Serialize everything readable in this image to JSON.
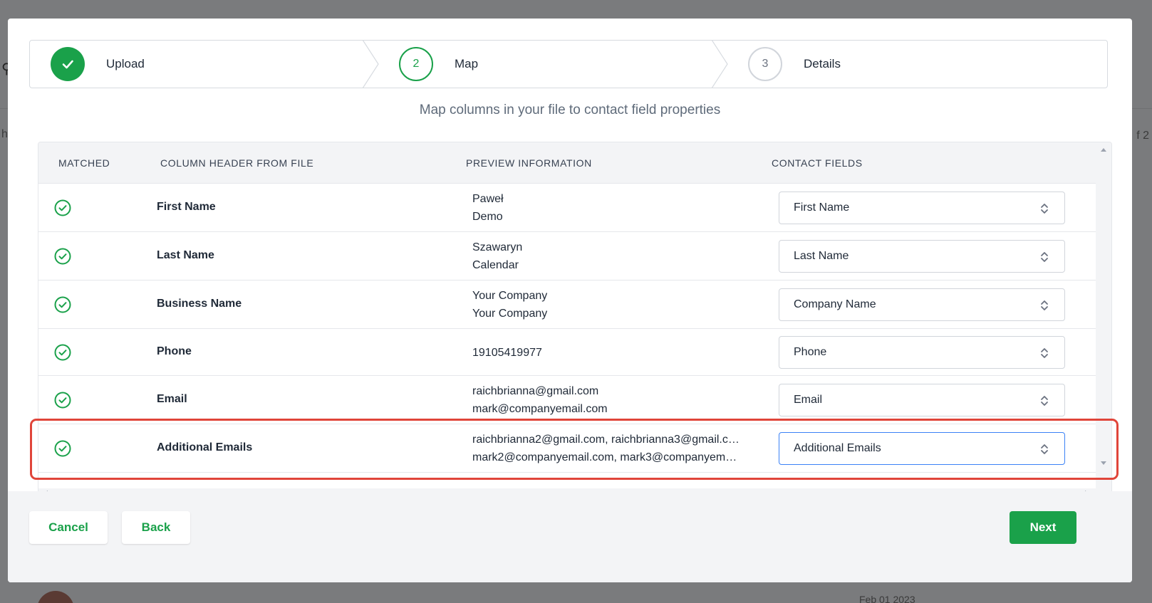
{
  "background": {
    "left_fragment": "h",
    "right_fragment": "f 2",
    "date_fragment": "Feb 01 2023"
  },
  "stepper": {
    "steps": [
      {
        "number": "1",
        "label": "Upload",
        "state": "done"
      },
      {
        "number": "2",
        "label": "Map",
        "state": "active"
      },
      {
        "number": "3",
        "label": "Details",
        "state": "todo"
      }
    ]
  },
  "subtitle": "Map columns in your file to contact field properties",
  "table": {
    "headers": {
      "matched": "MATCHED",
      "column_header": "COLUMN HEADER FROM FILE",
      "preview": "PREVIEW INFORMATION",
      "contact_fields": "CONTACT FIELDS"
    },
    "rows": [
      {
        "column": "First Name",
        "preview": [
          "Paweł",
          "Demo"
        ],
        "field": "First Name"
      },
      {
        "column": "Last Name",
        "preview": [
          "Szawaryn",
          "Calendar"
        ],
        "field": "Last Name"
      },
      {
        "column": "Business Name",
        "preview": [
          "Your Company",
          "Your Company"
        ],
        "field": "Company Name"
      },
      {
        "column": "Phone",
        "preview": [
          "19105419977"
        ],
        "field": "Phone"
      },
      {
        "column": "Email",
        "preview": [
          "raichbrianna@gmail.com",
          "mark@companyemail.com"
        ],
        "field": "Email"
      },
      {
        "column": "Additional Emails",
        "preview": [
          "raichbrianna2@gmail.com, raichbrianna3@gmail.c…",
          "mark2@companyemail.com, mark3@companyem…"
        ],
        "field": "Additional Emails"
      }
    ]
  },
  "footer": {
    "cancel_label": "Cancel",
    "back_label": "Back",
    "next_label": "Next"
  },
  "colors": {
    "accent": "#1aa14a",
    "highlight": "#e0453a",
    "focus": "#3b82f6"
  }
}
